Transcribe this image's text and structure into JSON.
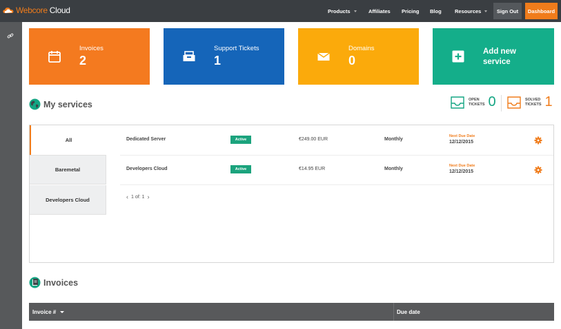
{
  "topbar": {
    "logo_brand": "Webcore",
    "logo_rest": " Cloud",
    "nav": [
      {
        "label": "Products",
        "dropdown": true
      },
      {
        "label": "Affiliates",
        "dropdown": false
      },
      {
        "label": "Pricing",
        "dropdown": false
      },
      {
        "label": "Blog",
        "dropdown": false
      },
      {
        "label": "Resources",
        "dropdown": true
      }
    ],
    "signout_label": "Sign Out",
    "dashboard_label": "Dashboard"
  },
  "tiles": {
    "invoices": {
      "label": "Invoices",
      "count": "2",
      "color": "#f47a1f",
      "icon": "calendar-icon"
    },
    "support": {
      "label": "Support Tickets",
      "count": "1",
      "color": "#1565b9",
      "icon": "inbox-icon"
    },
    "domains": {
      "label": "Domains",
      "count": "0",
      "color": "#fbaa0b",
      "icon": "envelope-icon"
    },
    "add": {
      "label_line1": "Add new",
      "label_line2": "service",
      "color": "#14ae8a",
      "icon": "plus-icon"
    }
  },
  "services": {
    "title": "My services",
    "open_tickets": {
      "label_line1": "OPEN",
      "label_line2": "TICKETS",
      "count": "0",
      "color": "#14a583"
    },
    "solved_tickets": {
      "label_line1": "SOLVED",
      "label_line2": "TICKETS",
      "count": "1",
      "color": "#f07c1b"
    },
    "categories": [
      "All",
      "Baremetal",
      "Developers Cloud"
    ],
    "active_category": "All",
    "rows": [
      {
        "name": "Dedicated Server",
        "status": "Active",
        "price": "€249.00 EUR",
        "cycle": "Monthly",
        "due_label": "Next Due Date",
        "due_date": "12/12/2015"
      },
      {
        "name": "Developers Cloud",
        "status": "Active",
        "price": "€14.95 EUR",
        "cycle": "Monthly",
        "due_label": "Next Due Date",
        "due_date": "12/12/2015"
      }
    ],
    "pager_text": "1 of: 1"
  },
  "invoices": {
    "title": "Invoices",
    "columns": [
      "Invoice #",
      "Due date"
    ]
  }
}
